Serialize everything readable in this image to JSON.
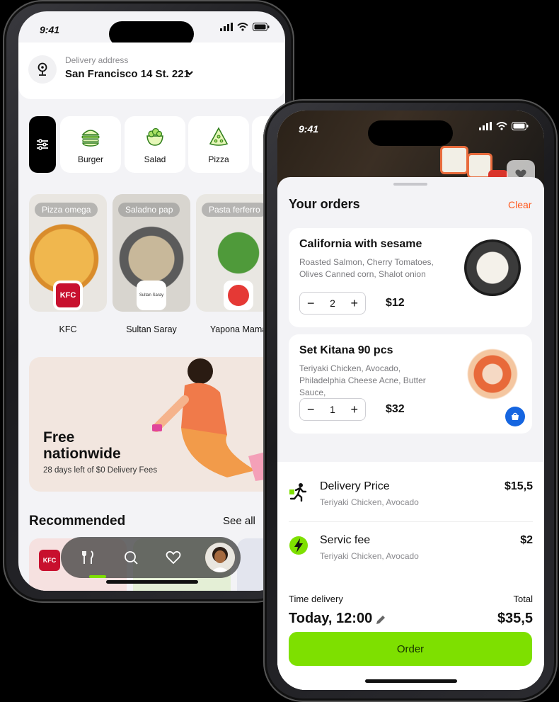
{
  "status": {
    "time": "9:41"
  },
  "home": {
    "address_label": "Delivery address",
    "address_value": "San Francisco 14 St. 221",
    "categories": [
      {
        "label": "Burger",
        "icon": "burger-icon"
      },
      {
        "label": "Salad",
        "icon": "salad-icon"
      },
      {
        "label": "Pizza",
        "icon": "pizza-icon"
      }
    ],
    "restaurants": [
      {
        "tag": "Pizza omega",
        "name": "KFC"
      },
      {
        "tag": "Saladno pap",
        "name": "Sultan Saray",
        "logo_text": "Sultan Saray"
      },
      {
        "tag": "Pasta ferferro",
        "name": "Yapona Mama"
      }
    ],
    "promo_title": "Free nationwide",
    "promo_subtitle": "28 days left of $0 Delivery Fees",
    "recommended_title": "Recommended",
    "see_all": "See all",
    "kfc_logo_text": "KFC"
  },
  "orders": {
    "title": "Your orders",
    "clear": "Clear",
    "items": [
      {
        "name": "California with sesame",
        "desc": "Roasted Salmon, Cherry Tomatoes, Olives Canned corn, Shalot onion",
        "qty": "2",
        "price": "$12"
      },
      {
        "name": "Set Kitana 90 pcs",
        "desc": "Teriyaki Chicken, Avocado, Philadelphia Cheese Acne, Butter Sauce,",
        "qty": "1",
        "price": "$32"
      }
    ],
    "fees": [
      {
        "name": "Delivery Price",
        "sub": "Teriyaki Chicken, Avocado",
        "amount": "$15,5"
      },
      {
        "name": "Servic fee",
        "sub": "Teriyaki Chicken, Avocado",
        "amount": "$2"
      }
    ],
    "time_label": "Time delivery",
    "time_value": "Today, 12:00",
    "total_label": "Total",
    "total_value": "$35,5",
    "order_button": "Order",
    "accent_color": "#7ee000",
    "clear_color": "#ff5a1f"
  }
}
